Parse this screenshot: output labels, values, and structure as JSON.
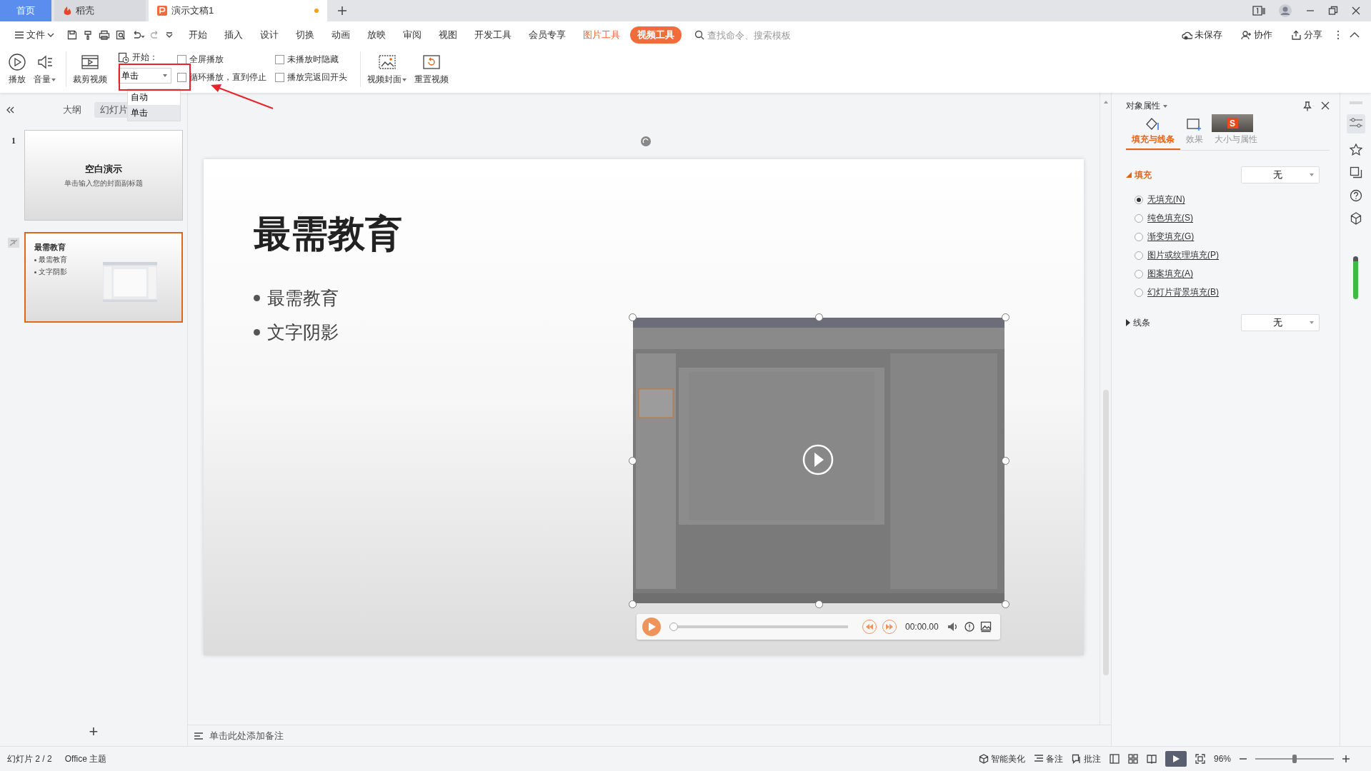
{
  "tabs": [
    {
      "label": "首页",
      "kind": "home",
      "selected": false
    },
    {
      "label": "稻壳",
      "kind": "app",
      "selected": false
    },
    {
      "label": "演示文稿1",
      "kind": "doc",
      "selected": true,
      "unsaved": true
    }
  ],
  "menu": {
    "file": "文件",
    "items": [
      {
        "label": "开始",
        "kind": "plain",
        "selected": false
      },
      {
        "label": "插入",
        "kind": "plain",
        "selected": false
      },
      {
        "label": "设计",
        "kind": "plain",
        "selected": false
      },
      {
        "label": "切换",
        "kind": "plain",
        "selected": false
      },
      {
        "label": "动画",
        "kind": "plain",
        "selected": false
      },
      {
        "label": "放映",
        "kind": "plain",
        "selected": false
      },
      {
        "label": "审阅",
        "kind": "plain",
        "selected": false
      },
      {
        "label": "视图",
        "kind": "plain",
        "selected": false
      },
      {
        "label": "开发工具",
        "kind": "plain",
        "selected": false
      },
      {
        "label": "会员专享",
        "kind": "plain",
        "selected": false
      },
      {
        "label": "图片工具",
        "kind": "tool",
        "selected": false
      },
      {
        "label": "视频工具",
        "kind": "tool",
        "selected": true
      }
    ],
    "search": {
      "placeholder": "查找命令、搜索模板"
    },
    "actions": [
      "未保存",
      "协作",
      "分享"
    ]
  },
  "ribbon": {
    "play": "播放",
    "volume": "音量",
    "trim": "裁剪视频",
    "start_label": "开始：",
    "start_value": "单击",
    "start_options": [
      {
        "label": "自动",
        "selected": false
      },
      {
        "label": "单击",
        "selected": true
      }
    ],
    "checkboxes": [
      {
        "label": "全屏播放",
        "checked": false
      },
      {
        "label": "循环播放，直到停止",
        "checked": false
      },
      {
        "label": "未播放时隐藏",
        "checked": false
      },
      {
        "label": "播放完返回开头",
        "checked": false
      }
    ],
    "cover": "视频封面",
    "reset": "重置视频"
  },
  "left_panel": {
    "tabs": [
      {
        "label": "大纲",
        "selected": false
      },
      {
        "label": "幻灯片",
        "selected": true
      }
    ],
    "slides": [
      {
        "number": "1",
        "title": "空白演示",
        "subtitle": "单击输入您的封面副标题",
        "has_media": false,
        "selected": false
      },
      {
        "title": "最需教育",
        "bullets": [
          "最需教育",
          "文字阴影"
        ],
        "has_media": true,
        "selected": true
      }
    ],
    "add": "+"
  },
  "slide": {
    "title": "最需教育",
    "bullets": [
      "最需教育",
      "文字阴影"
    ],
    "video": {
      "kind": "picture",
      "progress": {
        "level": 0
      },
      "time": "00:00.00"
    }
  },
  "notes": {
    "placeholder": "单击此处添加备注"
  },
  "properties": {
    "title": "对象属性",
    "ime_logo": "S",
    "tabs": [
      {
        "label": "填充与线条",
        "selected": true
      },
      {
        "label": "效果",
        "selected": false
      },
      {
        "label": "大小与属性",
        "selected": false
      }
    ],
    "sections": [
      {
        "label": "填充",
        "expanded": true,
        "value": "无",
        "options": [
          {
            "label": "无填充(N)",
            "selected": true
          },
          {
            "label": "纯色填充(S)",
            "selected": false
          },
          {
            "label": "渐变填充(G)",
            "selected": false
          },
          {
            "label": "图片或纹理填充(P)",
            "selected": false
          },
          {
            "label": "图案填充(A)",
            "selected": false
          },
          {
            "label": "幻灯片背景填充(B)",
            "selected": false
          }
        ]
      },
      {
        "label": "线条",
        "expanded": false,
        "value": "无"
      }
    ]
  },
  "status_bar": {
    "slide": "幻灯片 2 / 2",
    "theme": "Office 主题",
    "beautify": "智能美化",
    "notes": "备注",
    "comment": "批注",
    "zoom": "96%",
    "zoom_slider": {
      "level": 0.5
    }
  }
}
